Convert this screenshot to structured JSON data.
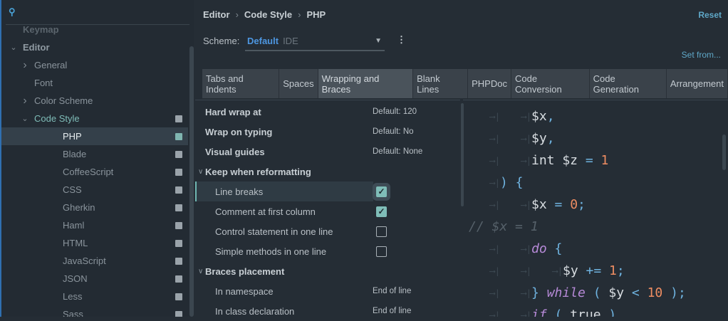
{
  "sidebar": {
    "search_icon": "search-icon",
    "items": [
      {
        "label": "Keymap",
        "level": 0,
        "chev": ""
      },
      {
        "label": "Editor",
        "level": 0,
        "chev": "v",
        "bold": true
      },
      {
        "label": "General",
        "level": 1,
        "chev": ">"
      },
      {
        "label": "Font",
        "level": 1,
        "chev": ""
      },
      {
        "label": "Color Scheme",
        "level": 1,
        "chev": ">"
      },
      {
        "label": "Code Style",
        "level": 1,
        "chev": "v",
        "badge": true,
        "accent": true
      },
      {
        "label": "PHP",
        "level": 2,
        "chev": "",
        "badge": true,
        "selected": true
      },
      {
        "label": "Blade",
        "level": 2,
        "chev": "",
        "badge": true
      },
      {
        "label": "CoffeeScript",
        "level": 2,
        "chev": "",
        "badge": true
      },
      {
        "label": "CSS",
        "level": 2,
        "chev": "",
        "badge": true
      },
      {
        "label": "Gherkin",
        "level": 2,
        "chev": "",
        "badge": true
      },
      {
        "label": "Haml",
        "level": 2,
        "chev": "",
        "badge": true
      },
      {
        "label": "HTML",
        "level": 2,
        "chev": "",
        "badge": true
      },
      {
        "label": "JavaScript",
        "level": 2,
        "chev": "",
        "badge": true
      },
      {
        "label": "JSON",
        "level": 2,
        "chev": "",
        "badge": true
      },
      {
        "label": "Less",
        "level": 2,
        "chev": "",
        "badge": true
      },
      {
        "label": "Sass",
        "level": 2,
        "chev": "",
        "badge": true
      }
    ]
  },
  "header": {
    "breadcrumb": [
      "Editor",
      "Code Style",
      "PHP"
    ],
    "separator": "›",
    "reset": "Reset"
  },
  "scheme": {
    "label": "Scheme:",
    "name": "Default",
    "type": "IDE",
    "set_from": "Set from..."
  },
  "tabs": [
    "Tabs and Indents",
    "Spaces",
    "Wrapping and Braces",
    "Blank Lines",
    "PHPDoc",
    "Code Conversion",
    "Code Generation",
    "Arrangement"
  ],
  "active_tab": 2,
  "options": [
    {
      "label": "Hard wrap at",
      "value": "Default: 120",
      "kind": "h"
    },
    {
      "label": "Wrap on typing",
      "value": "Default: No",
      "kind": "h"
    },
    {
      "label": "Visual guides",
      "value": "Default: None",
      "kind": "h"
    },
    {
      "label": "Keep when reformatting",
      "kind": "g"
    },
    {
      "label": "Line breaks",
      "checked": true,
      "highlight": true
    },
    {
      "label": "Comment at first column",
      "checked": true
    },
    {
      "label": "Control statement in one line",
      "checked": false
    },
    {
      "label": "Simple methods in one line",
      "checked": false
    },
    {
      "label": "Braces placement",
      "kind": "g"
    },
    {
      "label": "In namespace",
      "value": "End of line"
    },
    {
      "label": "In class declaration",
      "value": "End of line"
    }
  ],
  "code": [
    {
      "indent": 2,
      "tokens": [
        [
          "$x",
          ""
        ],
        [
          ",",
          "op"
        ]
      ]
    },
    {
      "indent": 2,
      "tokens": [
        [
          "$y",
          ""
        ],
        [
          ",",
          "op"
        ]
      ]
    },
    {
      "indent": 2,
      "tokens": [
        [
          "int $z ",
          ""
        ],
        [
          "=",
          "op"
        ],
        [
          " ",
          ""
        ],
        [
          "1",
          "num"
        ]
      ]
    },
    {
      "indent": 1,
      "tokens": [
        [
          ") {",
          "op"
        ]
      ]
    },
    {
      "indent": 2,
      "tokens": [
        [
          "$x ",
          ""
        ],
        [
          "=",
          "op"
        ],
        [
          " ",
          ""
        ],
        [
          "0",
          "num"
        ],
        [
          ";",
          "op"
        ]
      ]
    },
    {
      "indent": 0,
      "tokens": [
        [
          "// $x = 1",
          "cm"
        ]
      ]
    },
    {
      "indent": 2,
      "tokens": [
        [
          "do",
          "kw"
        ],
        [
          " {",
          "op"
        ]
      ]
    },
    {
      "indent": 3,
      "tokens": [
        [
          "$y ",
          ""
        ],
        [
          "+=",
          "op"
        ],
        [
          " ",
          ""
        ],
        [
          "1",
          "num"
        ],
        [
          ";",
          "op"
        ]
      ]
    },
    {
      "indent": 2,
      "tokens": [
        [
          "}",
          "op"
        ],
        [
          " ",
          ""
        ],
        [
          "while",
          "kw"
        ],
        [
          " ( ",
          "op"
        ],
        [
          "$y ",
          ""
        ],
        [
          "<",
          "op"
        ],
        [
          " ",
          ""
        ],
        [
          "10",
          "num"
        ],
        [
          " );",
          "op"
        ]
      ]
    },
    {
      "indent": 2,
      "tokens": [
        [
          "if",
          "kw"
        ],
        [
          " ( ",
          "op"
        ],
        [
          "true",
          ""
        ],
        [
          " )",
          "op"
        ]
      ]
    }
  ],
  "colors": {
    "accent": "#4d96e0",
    "link": "#5fa8c8",
    "checkbox": "#7fbdb8",
    "number": "#ee8d62",
    "keyword": "#b78ad8"
  }
}
